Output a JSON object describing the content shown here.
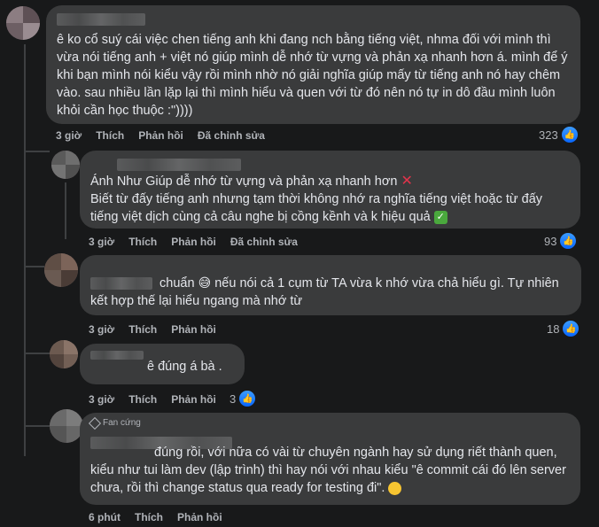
{
  "comments": [
    {
      "text": "ê ko cổ suý cái việc chen tiếng anh khi đang nch bằng tiếng việt, nhma đối với mình thì vừa nói tiếng anh + việt nó giúp mình dễ nhớ từ vựng và phản xạ nhanh hơn á. mình để ý khi bạn mình nói kiểu vậy rồi mình nhờ nó giải nghĩa giúp mấy từ tiếng anh nó hay chêm vào. sau nhiều lần lặp lại thì mình hiểu và quen với từ đó nên nó tự in dô đầu mình luôn khỏi cần học thuộc :\")))) ",
      "time": "3 giờ",
      "like": "Thích",
      "reply": "Phản hồi",
      "edited": "Đã chỉnh sửa",
      "count": "323"
    },
    {
      "line1": "Ánh Như Giúp dễ nhớ từ vựng và phản xạ nhanh hơn",
      "line2": "Biết từ đấy tiếng anh nhưng tạm thời không nhớ ra nghĩa tiếng việt hoặc từ đấy tiếng việt dịch cùng cả câu nghe bị cồng kềnh và k hiệu quả",
      "time": "3 giờ",
      "like": "Thích",
      "reply": "Phản hồi",
      "edited": "Đã chỉnh sửa",
      "count": "93"
    },
    {
      "text_a": "chuẩn",
      "text_b": "nếu nói cả 1 cụm từ TA vừa k nhớ vừa chả hiểu gì. Tự nhiên kết hợp thế lại hiểu ngang mà nhớ từ",
      "time": "3 giờ",
      "like": "Thích",
      "reply": "Phản hồi",
      "count": "18"
    },
    {
      "text": "ê đúng á bà .",
      "time": "3 giờ",
      "like": "Thích",
      "reply": "Phản hồi",
      "count": "3"
    },
    {
      "badge": "Fan cứng",
      "text_a": "đúng rồi, với nữa có vài từ chuyên ngành hay sử dụng riết thành quen, kiểu như tui làm dev (lập trình) thì hay nói với nhau kiểu \"ê commit cái đó lên server chưa, rồi thì change status qua ready for testing đi\".",
      "time": "6 phút",
      "like": "Thích",
      "reply": "Phản hồi"
    }
  ],
  "colors": {
    "background": "#18191a",
    "bubble": "#3a3b3c",
    "text": "#e4e6eb",
    "secondary": "#b0b3b8",
    "like_blue": "#0866ff"
  },
  "icons": [
    "like-icon",
    "cross-mark-icon",
    "check-mark-icon",
    "sweat-smile-icon",
    "rofl-icon",
    "diamond-icon"
  ]
}
